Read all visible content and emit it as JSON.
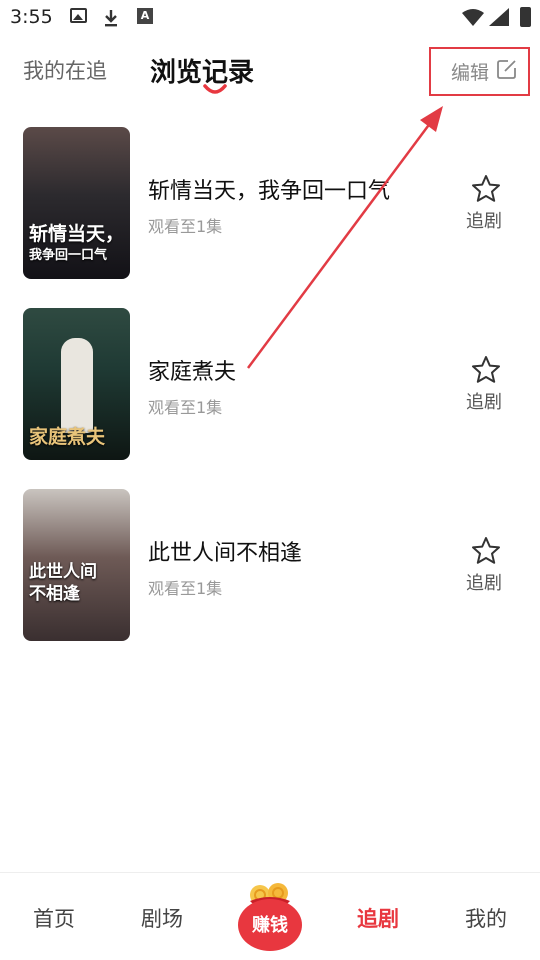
{
  "status_bar": {
    "time": "3:55",
    "icons": [
      "image-icon",
      "download-icon",
      "a-icon",
      "wifi-icon",
      "signal-icon",
      "battery-icon"
    ]
  },
  "header": {
    "tabs": [
      {
        "label": "我的在追",
        "active": false
      },
      {
        "label": "浏览记录",
        "active": true
      }
    ],
    "edit_label": "编辑",
    "accent_color": "#e8373f"
  },
  "history": [
    {
      "title": "斩情当天，我争回一口气",
      "progress": "观看至1集",
      "follow_label": "追剧",
      "poster_text": [
        "斩情当天，",
        "我争回一口气"
      ],
      "poster_color": "#2c2a2e"
    },
    {
      "title": "家庭煮夫",
      "progress": "观看至1集",
      "follow_label": "追剧",
      "poster_text": [
        "家庭煮夫"
      ],
      "poster_color": "#1f3a34"
    },
    {
      "title": "此世人间不相逢",
      "progress": "观看至1集",
      "follow_label": "追剧",
      "poster_text": [
        "此世人间",
        "不相逢"
      ],
      "poster_color": "#3a2f30"
    }
  ],
  "bottom_nav": {
    "items": [
      {
        "label": "首页"
      },
      {
        "label": "剧场"
      },
      {
        "label": "赚钱"
      },
      {
        "label": "追剧",
        "active": true
      },
      {
        "label": "我的"
      }
    ]
  }
}
